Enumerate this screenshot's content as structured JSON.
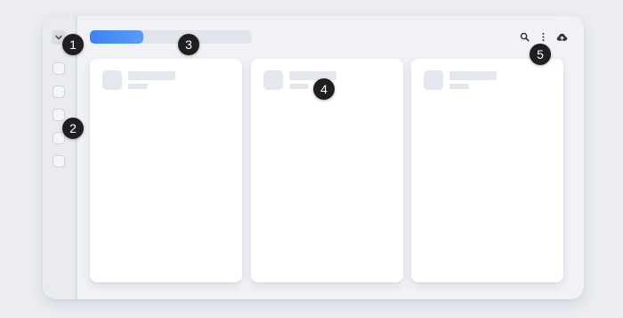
{
  "colors": {
    "page_background": "#eceef3",
    "window_background": "#f0f2f6",
    "accent": "#3b82f6",
    "placeholder": "#e4e7ed",
    "marker": "#1f1f22",
    "icon": "#333333"
  },
  "rail": {
    "toggle_icon": "chevron-down-icon",
    "items": [
      {
        "id": "nav-1"
      },
      {
        "id": "nav-2"
      },
      {
        "id": "nav-3"
      },
      {
        "id": "nav-4"
      },
      {
        "id": "nav-5"
      }
    ]
  },
  "toolbar": {
    "icons": [
      "search-icon",
      "more-vertical-icon",
      "cloud-upload-icon"
    ]
  },
  "cards": [
    {
      "id": "card-1"
    },
    {
      "id": "card-2"
    },
    {
      "id": "card-3"
    }
  ],
  "markers": [
    "1",
    "2",
    "3",
    "4",
    "5"
  ]
}
